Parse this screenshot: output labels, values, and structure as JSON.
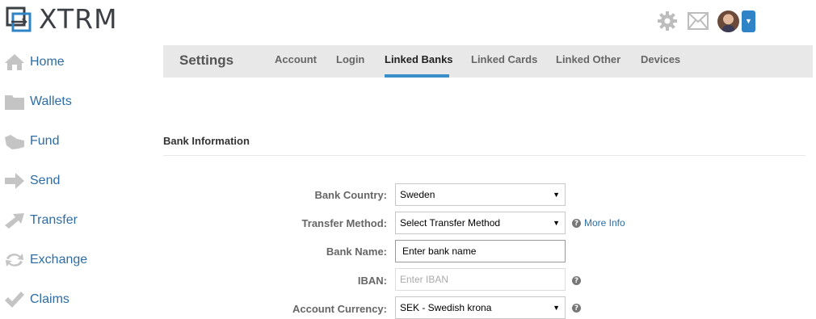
{
  "brand": {
    "name": "XTRM",
    "accent_color": "#2e84c6"
  },
  "topbar": {
    "icons": [
      "gear-icon",
      "mail-icon",
      "avatar",
      "chevron-down-icon"
    ]
  },
  "sidebar": {
    "items": [
      {
        "label": "Home",
        "icon": "home-icon"
      },
      {
        "label": "Wallets",
        "icon": "folder-icon"
      },
      {
        "label": "Fund",
        "icon": "fund-icon"
      },
      {
        "label": "Send",
        "icon": "arrow-right-icon"
      },
      {
        "label": "Transfer",
        "icon": "transfer-icon"
      },
      {
        "label": "Exchange",
        "icon": "exchange-icon"
      },
      {
        "label": "Claims",
        "icon": "check-icon"
      }
    ]
  },
  "settings": {
    "title": "Settings",
    "tabs": [
      {
        "label": "Account",
        "active": false
      },
      {
        "label": "Login",
        "active": false
      },
      {
        "label": "Linked Banks",
        "active": true
      },
      {
        "label": "Linked Cards",
        "active": false
      },
      {
        "label": "Linked Other",
        "active": false
      },
      {
        "label": "Devices",
        "active": false
      }
    ]
  },
  "bank_info": {
    "section_title": "Bank Information",
    "bank_country": {
      "label": "Bank Country:",
      "value": "Sweden"
    },
    "transfer_method": {
      "label": "Transfer Method:",
      "value": "Select Transfer Method",
      "more_info": "More Info"
    },
    "bank_name": {
      "label": "Bank Name:",
      "placeholder": "Enter bank name"
    },
    "iban": {
      "label": "IBAN:",
      "placeholder": "Enter IBAN"
    },
    "account_currency": {
      "label": "Account Currency:",
      "value": "SEK - Swedish krona"
    }
  },
  "help_glyph": "?"
}
